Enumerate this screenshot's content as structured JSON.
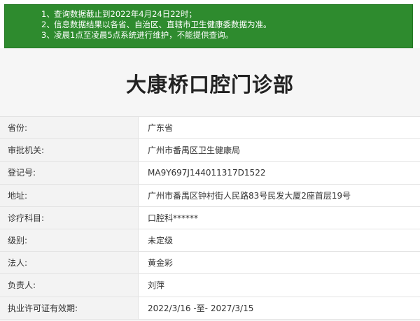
{
  "notice": {
    "lines": [
      {
        "num": "1、",
        "text": "查询数据截止到2022年4月24日22时；"
      },
      {
        "num": "2、",
        "text": "信息数据结果以各省、自治区、直辖市卫生健康委数据为准。"
      },
      {
        "num": "3、",
        "text": "凌晨1点至凌晨5点系统进行维护，不能提供查询。"
      }
    ]
  },
  "page_title": "大康桥口腔门诊部",
  "rows": [
    {
      "label": "省份:",
      "value": "广东省"
    },
    {
      "label": "审批机关:",
      "value": "广州市番禺区卫生健康局"
    },
    {
      "label": "登记号:",
      "value": "MA9Y697J144011317D1522"
    },
    {
      "label": "地址:",
      "value": "广州市番禺区钟村街人民路83号民发大厦2座首层19号"
    },
    {
      "label": "诊疗科目:",
      "value": "口腔科******"
    },
    {
      "label": "级别:",
      "value": "未定级"
    },
    {
      "label": "法人:",
      "value": "黄金彩"
    },
    {
      "label": "负责人:",
      "value": "刘萍"
    },
    {
      "label": "执业许可证有效期:",
      "value": "2022/3/16 -至- 2027/3/15"
    }
  ],
  "colors": {
    "notice_bg": "#2e8b2e",
    "label_bg": "#f3f3f3",
    "border": "#e3e3e3"
  }
}
